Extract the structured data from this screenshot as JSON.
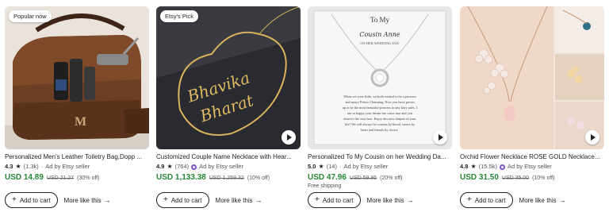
{
  "listings": [
    {
      "badge": "Popular now",
      "title": "Personalized Men's Leather Toiletry Bag,Dopp ...",
      "rating": "4.3",
      "review_count": "(1.3k)",
      "ad_label": "Ad by Etsy seller",
      "price": "USD 14.89",
      "original_price": "USD 21.27",
      "discount": "(30% off)",
      "shipping": "",
      "has_video": false,
      "image_icon": "leather-toiletry-bag-photo",
      "add_to_cart": "Add to cart",
      "more_like_this": "More like this"
    },
    {
      "badge": "Etsy's Pick",
      "title": "Customized Couple Name Necklace with Hear...",
      "rating": "4.9",
      "review_count": "(764)",
      "ad_label": "Ad by Etsy seller",
      "price": "USD 1,133.38",
      "original_price": "USD 1,259.32",
      "discount": "(10% off)",
      "shipping": "",
      "has_video": true,
      "image_icon": "gold-name-necklace-photo",
      "image_text_1": "Bhavika",
      "image_text_2": "Bharat",
      "add_to_cart": "Add to cart",
      "more_like_this": "More like this"
    },
    {
      "badge": "",
      "title": "Personalized To My Cousin on her Wedding Da...",
      "rating": "5.0",
      "review_count": "(14)",
      "ad_label": "Ad by Etsy seller",
      "price": "USD 47.96",
      "original_price": "USD 59.95",
      "discount": "(20% off)",
      "shipping": "Free shipping",
      "has_video": true,
      "image_icon": "cousin-necklace-card-photo",
      "card_heading": "To My",
      "card_name": "Cousin Anne",
      "card_sub": "ON HER WEDDING DAY",
      "card_poem": [
        "When we were little, we both wished to be a princess",
        "and marry Prince Charming. Now you have grown",
        "up to be the most beautiful princess in any fairy tales. I",
        "am so happy your dream has come true and you",
        "deserve the very best. Enjoy this new chapter of your",
        "life! We will always be cousins by blood, sisters by",
        "heart and friends by choice."
      ],
      "add_to_cart": "Add to cart",
      "more_like_this": "More like this"
    },
    {
      "badge": "",
      "title": "Orchid Flower Necklace ROSE GOLD Necklace...",
      "rating": "4.8",
      "review_count": "(15.5k)",
      "ad_label": "Ad by Etsy seller",
      "price": "USD 31.50",
      "original_price": "USD 35.00",
      "discount": "(10% off)",
      "shipping": "",
      "has_video": true,
      "image_icon": "orchid-flower-necklace-photo",
      "add_to_cart": "Add to cart",
      "more_like_this": "More like this"
    }
  ],
  "colors": {
    "price_green": "#258635",
    "ad_star_purple": "#7d55c7"
  }
}
